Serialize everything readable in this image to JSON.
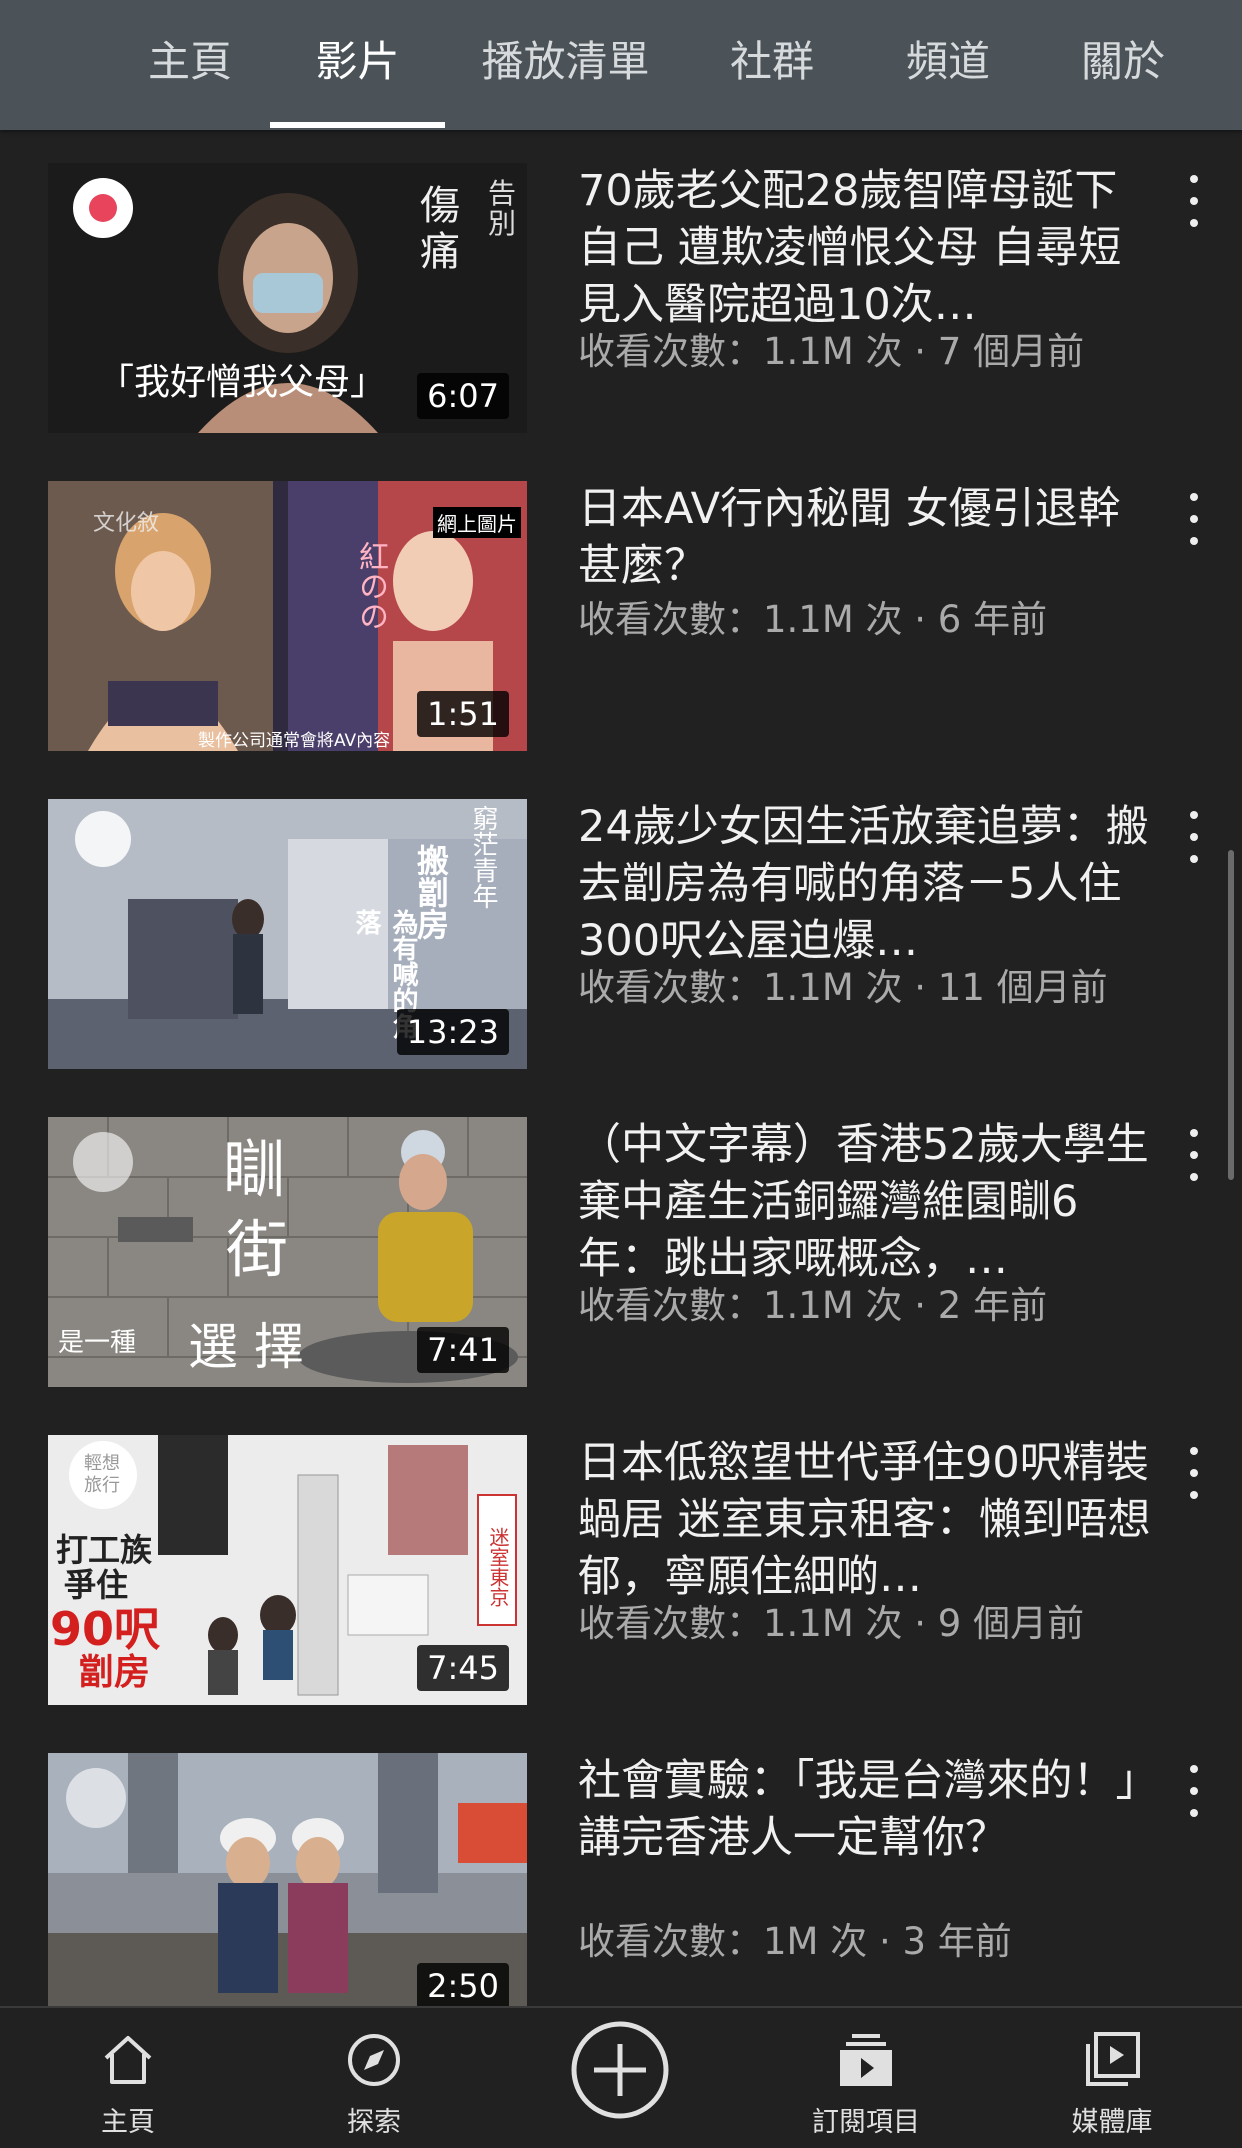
{
  "tabs": [
    {
      "label": "主頁",
      "active": false
    },
    {
      "label": "影片",
      "active": true
    },
    {
      "label": "播放清單",
      "active": false
    },
    {
      "label": "社群",
      "active": false
    },
    {
      "label": "頻道",
      "active": false
    },
    {
      "label": "關於",
      "active": false
    }
  ],
  "videos": [
    {
      "title": "70歲老父配28歲智障母誕下自己 遭欺凌憎恨父母 自尋短見入醫院超過10次…",
      "meta": "收看次數：1.1M 次 · 7 個月前",
      "duration": "6:07",
      "thumb_text": [
        "告別",
        "傷痛",
        "「我好憎我父母」"
      ],
      "thumb_color": "#2a2a2a"
    },
    {
      "title": "日本AV行內秘聞 女優引退幹甚麼？",
      "meta": "收看次數：1.1M 次 · 6 年前",
      "duration": "1:51",
      "thumb_text": [
        "文化敘",
        "網上圖片",
        "紅のの",
        "製作公司通常會將AV內容"
      ],
      "thumb_color": "#5b4a44"
    },
    {
      "title": "24歲少女因生活放棄追夢：搬去劏房為有喊的角落－5人住300呎公屋迫爆…",
      "meta": "收看次數：1.1M 次 · 11 個月前",
      "duration": "13:23",
      "thumb_text": [
        "窮茫青年",
        "搬劏房",
        "為有喊的角落"
      ],
      "thumb_color": "#a7aebb"
    },
    {
      "title": "（中文字幕）香港52歲大學生棄中產生活銅鑼灣維園瞓6年：跳出家嘅概念，…",
      "meta": "收看次數：1.1M 次 · 2 年前",
      "duration": "7:41",
      "thumb_text": [
        "瞓",
        "街",
        "是一種",
        "選 擇"
      ],
      "thumb_color": "#8f8b86"
    },
    {
      "title": "日本低慾望世代爭住90呎精裝蝸居 迷室東京租客：懶到唔想郁，寧願住細啲…",
      "meta": "收看次數：1.1M 次 · 9 個月前",
      "duration": "7:45",
      "thumb_text": [
        "輕想旅行",
        "打工族",
        "爭住",
        "90呎",
        "劏房",
        "迷室東京"
      ],
      "thumb_color": "#e9e9e9"
    },
    {
      "title": "社會實驗：「我是台灣來的！」講完香港人一定幫你？",
      "meta": "收看次數：1M 次 · 3 年前",
      "duration": "2:50",
      "thumb_text": [],
      "thumb_color": "#7c7a78"
    }
  ],
  "bottom_nav": [
    {
      "label": "主頁",
      "icon": "home-icon"
    },
    {
      "label": "探索",
      "icon": "compass-icon"
    },
    {
      "label": "",
      "icon": "create-icon"
    },
    {
      "label": "訂閱項目",
      "icon": "subscriptions-icon"
    },
    {
      "label": "媒體庫",
      "icon": "library-icon"
    }
  ]
}
